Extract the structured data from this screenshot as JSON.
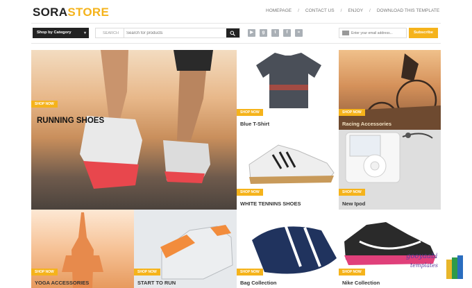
{
  "header": {
    "logo_part1": "SORA",
    "logo_part2": "STORE",
    "nav": [
      "HOMEPAGE",
      "CONTACT US",
      "ENJOY",
      "DOWNLOAD THIS TEMPLATE"
    ],
    "nav_separator": "/"
  },
  "toolbar": {
    "category_label": "Shop by Category",
    "search_label": "SEARCH",
    "search_placeholder": "Search for products",
    "social_icons": [
      "youtube-icon",
      "google-plus-icon",
      "twitter-icon",
      "facebook-icon",
      "rss-icon"
    ],
    "email_placeholder": "Enter your email address...",
    "subscribe_label": "Subscribe"
  },
  "tiles": [
    {
      "title": "RUNNING SHOES",
      "badge": "SHOP NOW"
    },
    {
      "title": "Blue T-Shirt",
      "badge": "SHOP NOW"
    },
    {
      "title": "Racing Accessories",
      "badge": "SHOP NOW"
    },
    {
      "title": "WHITE TENNINS SHOES",
      "badge": "SHOP NOW"
    },
    {
      "title": "New Ipod",
      "badge": "SHOP NOW"
    },
    {
      "title": "YOGA ACCESSORIES",
      "badge": "SHOP NOW"
    },
    {
      "title": "START TO RUN",
      "badge": "SHOP NOW"
    },
    {
      "title": "Bag Collection",
      "badge": "SHOP NOW"
    },
    {
      "title": "Nike Collection",
      "badge": "SHOP NOW"
    }
  ],
  "watermark": {
    "text": "gooyaabi",
    "subtext": "templates"
  },
  "colors": {
    "accent": "#f5b31b",
    "dark": "#222222"
  }
}
